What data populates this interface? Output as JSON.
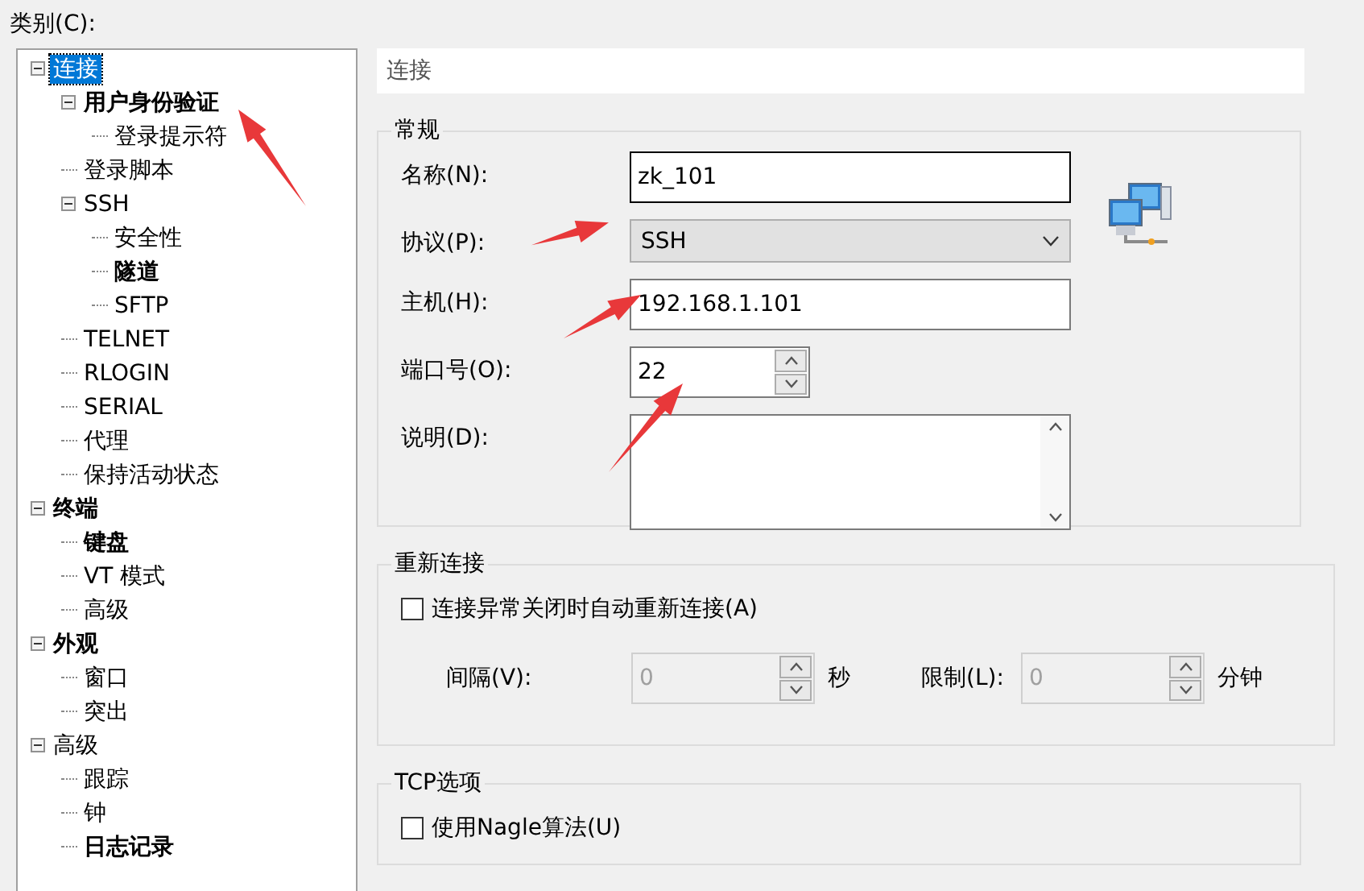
{
  "category_label": "类别(C):",
  "tree": [
    {
      "label": "连接",
      "selected": true,
      "bold": false,
      "expanded": true,
      "children": [
        {
          "label": "用户身份验证",
          "selected": false,
          "bold": true,
          "expanded": true,
          "children": [
            {
              "label": "登录提示符",
              "selected": false,
              "bold": false
            }
          ]
        },
        {
          "label": "登录脚本",
          "selected": false,
          "bold": false
        },
        {
          "label": "SSH",
          "selected": false,
          "bold": false,
          "expanded": true,
          "children": [
            {
              "label": "安全性",
              "selected": false,
              "bold": false
            },
            {
              "label": "隧道",
              "selected": false,
              "bold": true
            },
            {
              "label": "SFTP",
              "selected": false,
              "bold": false
            }
          ]
        },
        {
          "label": "TELNET",
          "selected": false,
          "bold": false
        },
        {
          "label": "RLOGIN",
          "selected": false,
          "bold": false
        },
        {
          "label": "SERIAL",
          "selected": false,
          "bold": false
        },
        {
          "label": "代理",
          "selected": false,
          "bold": false
        },
        {
          "label": "保持活动状态",
          "selected": false,
          "bold": false
        }
      ]
    },
    {
      "label": "终端",
      "selected": false,
      "bold": true,
      "expanded": true,
      "children": [
        {
          "label": "键盘",
          "selected": false,
          "bold": true
        },
        {
          "label": "VT 模式",
          "selected": false,
          "bold": false
        },
        {
          "label": "高级",
          "selected": false,
          "bold": false
        }
      ]
    },
    {
      "label": "外观",
      "selected": false,
      "bold": true,
      "expanded": true,
      "children": [
        {
          "label": "窗口",
          "selected": false,
          "bold": false
        },
        {
          "label": "突出",
          "selected": false,
          "bold": false
        }
      ]
    },
    {
      "label": "高级",
      "selected": false,
      "bold": false,
      "expanded": true,
      "children": [
        {
          "label": "跟踪",
          "selected": false,
          "bold": false
        },
        {
          "label": "钟",
          "selected": false,
          "bold": false
        },
        {
          "label": "日志记录",
          "selected": false,
          "bold": true
        }
      ]
    }
  ],
  "header": "连接",
  "general": {
    "title": "常规",
    "fields": [
      {
        "kind": "text",
        "label": "名称(N):",
        "value": "zk_101",
        "focused": true
      },
      {
        "kind": "select",
        "label": "协议(P):",
        "value": "SSH"
      },
      {
        "kind": "text",
        "label": "主机(H):",
        "value": "192.168.1.101",
        "focused": false
      },
      {
        "kind": "spin",
        "label": "端口号(O):",
        "value": "22"
      },
      {
        "kind": "textarea",
        "label": "说明(D):"
      }
    ]
  },
  "reconnect": {
    "title": "重新连接",
    "checkbox": {
      "label": "连接异常关闭时自动重新连接(A)",
      "checked": false
    },
    "spinners": [
      {
        "label": "间隔(V):",
        "value": "0",
        "unit": "秒",
        "disabled": true
      },
      {
        "label": "限制(L):",
        "value": "0",
        "unit": "分钟",
        "disabled": true
      }
    ]
  },
  "tcp": {
    "title": "TCP选项",
    "checkbox": {
      "label": "使用Nagle算法(U)",
      "checked": false
    }
  }
}
